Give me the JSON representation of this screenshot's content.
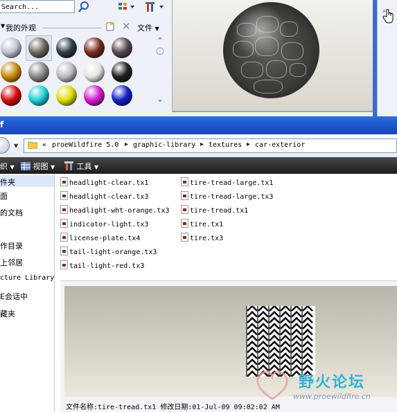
{
  "appearance_panel": {
    "search_text": "Search...",
    "library_label": "我的外观",
    "file_menu": "文件",
    "swatch_colors": [
      "#bfc6d1",
      "#6f6862",
      "#2f3d46",
      "#7a2c1e",
      "#5a4a52",
      "#c98a10",
      "#8a8a8a",
      "#bdbdbd",
      "#e6e6e6",
      "#202020",
      "#d41010",
      "#1fd1d9",
      "#e0dc0c",
      "#d61ad1",
      "#1420c8"
    ]
  },
  "explorer": {
    "title_fragment": "f",
    "breadcrumbs": [
      "«",
      "proeWildfire 5.0",
      "graphic-library",
      "textures",
      "car-exterior"
    ],
    "commands": {
      "organize": "织",
      "view": "视图",
      "tools": "工具"
    },
    "nav_items": [
      "件夹",
      "面",
      "的文档",
      "",
      "作目录",
      "上邻居",
      "cture Library",
      "E会话中",
      "藏夹"
    ],
    "files_col1": [
      "headlight-clear.tx1",
      "headlight-clear.tx3",
      "headlight-wht-orange.tx3",
      "indicator-light.tx3",
      "license-plate.tx4",
      "tail-light-orange.tx3",
      "tail-light-red.tx3"
    ],
    "files_col2": [
      "tire-tread-large.tx1",
      "tire-tread-large.tx3",
      "tire-tread.tx1",
      "tire.tx1",
      "tire.tx3"
    ]
  },
  "preview": {
    "watermark_cn": "野火论坛",
    "watermark_url": "www.proewildfire.cn",
    "file_info": "文件名称:tire-tread.tx1 修改日期:01-Jul-09 09:02:02 AM"
  }
}
